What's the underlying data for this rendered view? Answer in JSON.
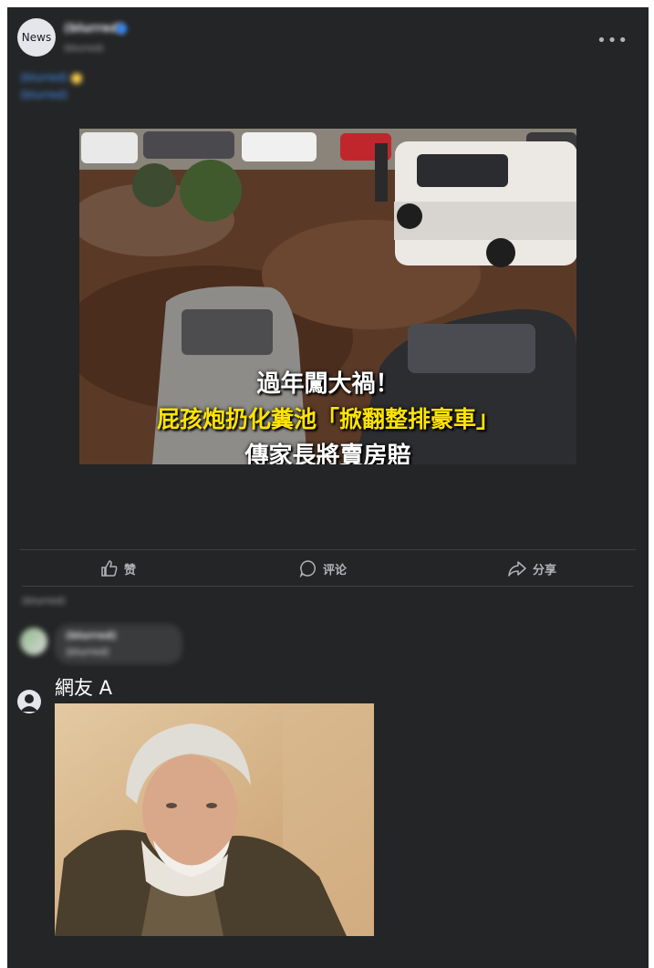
{
  "post": {
    "avatar_text": "News",
    "page_name": "(blurred)",
    "meta": "(blurred)",
    "text_line1": "(blurred)",
    "text_line2": "(blurred)"
  },
  "image_caption": {
    "line1": "過年闖大禍！",
    "line2": "屁孩炮扔化糞池「掀翻整排豪車」",
    "line3": "傳家長將賣房賠"
  },
  "actions": {
    "like": "赞",
    "comment": "评论",
    "share": "分享"
  },
  "comments": {
    "sort_label": "(blurred)",
    "first_name": "(blurred)",
    "first_text": "(blurred)",
    "reply_author": "網友 A"
  },
  "colors": {
    "background": "#242526",
    "text": "#e4e6eb",
    "muted": "#b0b3b8",
    "caption_yellow": "#ffe400"
  },
  "icons": [
    "more-icon",
    "like-icon",
    "comment-icon",
    "share-icon",
    "user-icon"
  ]
}
